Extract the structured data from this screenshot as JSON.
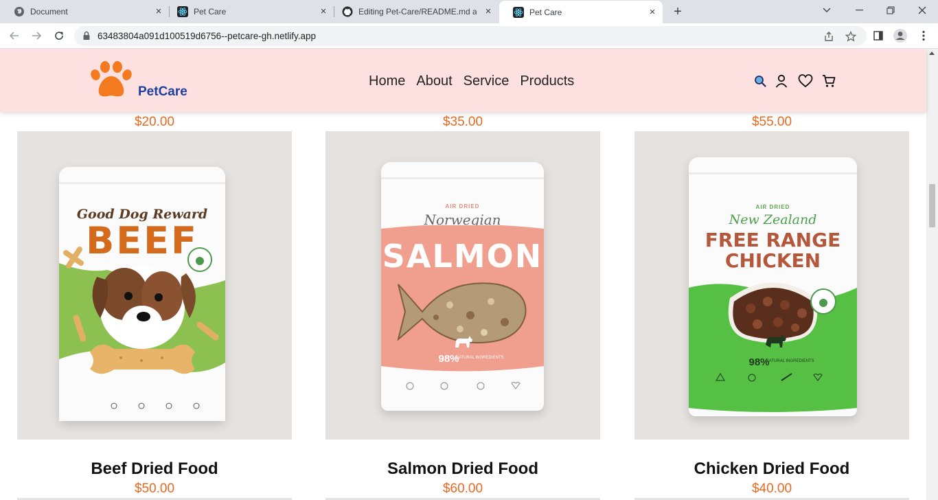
{
  "browser": {
    "tabs": [
      {
        "title": "Document",
        "icon": "globe-icon"
      },
      {
        "title": "Pet Care",
        "icon": "react-icon"
      },
      {
        "title": "Editing Pet-Care/README.md at",
        "icon": "github-icon"
      },
      {
        "title": "Pet Care",
        "icon": "react-icon",
        "active": true
      }
    ],
    "url": "63483804a091d100519d6756--petcare-gh.netlify.app"
  },
  "site": {
    "brand": "PetCare",
    "nav": [
      "Home",
      "About",
      "Service",
      "Products"
    ],
    "header_icons": [
      "search-icon",
      "user-icon",
      "heart-icon",
      "cart-icon"
    ],
    "colors": {
      "header_bg": "#fde0e0",
      "price": "#e8691f",
      "brand": "#1d3f9e",
      "logo": "#f47a20"
    }
  },
  "products": {
    "prev_prices": [
      "$20.00",
      "$35.00",
      "$55.00"
    ],
    "items": [
      {
        "name": "Beef Dried Food",
        "price": "$50.00",
        "pack": {
          "line1": "Good Dog Reward",
          "line2": "BEEF"
        }
      },
      {
        "name": "Salmon Dried Food",
        "price": "$60.00",
        "pack": {
          "line0": "AIR DRIED",
          "line1": "Norwegian",
          "line2": "SALMON",
          "percent": "98%",
          "note": "NATURAL INGREDIENTS"
        }
      },
      {
        "name": "Chicken Dried Food",
        "price": "$40.00",
        "pack": {
          "line0": "AIR DRIED",
          "line1": "New Zealand",
          "line2": "FREE RANGE",
          "line3": "CHICKEN",
          "percent": "98%",
          "note": "NATURAL INGREDIENTS"
        }
      }
    ]
  }
}
